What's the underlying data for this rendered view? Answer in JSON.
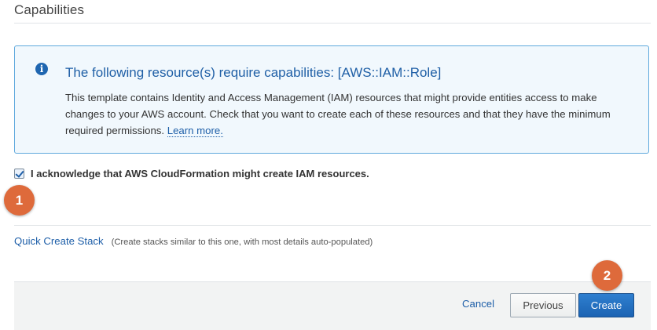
{
  "section": {
    "title": "Capabilities"
  },
  "info_box": {
    "icon": "info-icon",
    "icon_glyph": "i",
    "heading": "The following resource(s) require capabilities: [AWS::IAM::Role]",
    "body": "This template contains Identity and Access Management (IAM) resources that might provide entities access to make changes to your AWS account. Check that you want to create each of these resources and that they have the minimum required permissions.",
    "link": "Learn more."
  },
  "acknowledge": {
    "checked": true,
    "label": "I acknowledge that AWS CloudFormation might create IAM resources."
  },
  "annotations": {
    "step_1": "1",
    "step_2": "2"
  },
  "quick_create": {
    "link": "Quick Create Stack",
    "description": "(Create stacks similar to this one, with most details auto-populated)"
  },
  "footer": {
    "cancel_label": "Cancel",
    "previous_label": "Previous",
    "create_label": "Create"
  },
  "colors": {
    "link": "#1d5ea8",
    "info_border": "#5fa9dd",
    "info_background": "#f1f8fd",
    "primary_button": "#1f6ab9",
    "annotation_badge": "#de6a3b"
  }
}
